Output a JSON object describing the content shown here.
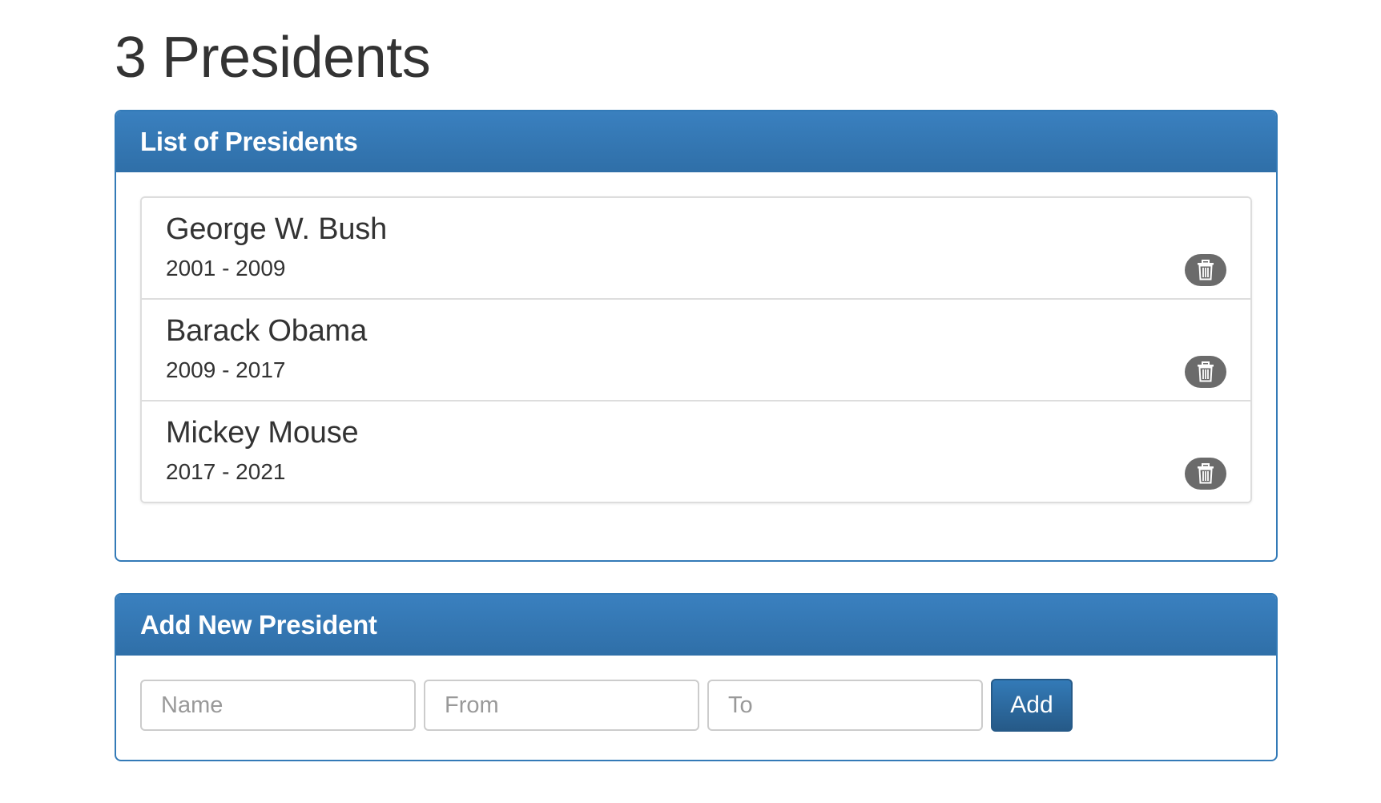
{
  "page": {
    "title": "3 Presidents"
  },
  "list_panel": {
    "heading": "List of Presidents",
    "items": [
      {
        "name": "George W. Bush",
        "years": "2001 - 2009",
        "action_icon": "trash-icon"
      },
      {
        "name": "Barack Obama",
        "years": "2009 - 2017",
        "action_icon": "trash-icon"
      },
      {
        "name": "Mickey Mouse",
        "years": "2017 - 2021",
        "action_icon": "trash-icon"
      }
    ]
  },
  "add_panel": {
    "heading": "Add New President",
    "name_placeholder": "Name",
    "from_placeholder": "From",
    "to_placeholder": "To",
    "add_label": "Add"
  },
  "colors": {
    "primary": "#337ab7",
    "primary_dark": "#265a88",
    "delete_button": "#6b6b6b",
    "border": "#dddddd"
  }
}
